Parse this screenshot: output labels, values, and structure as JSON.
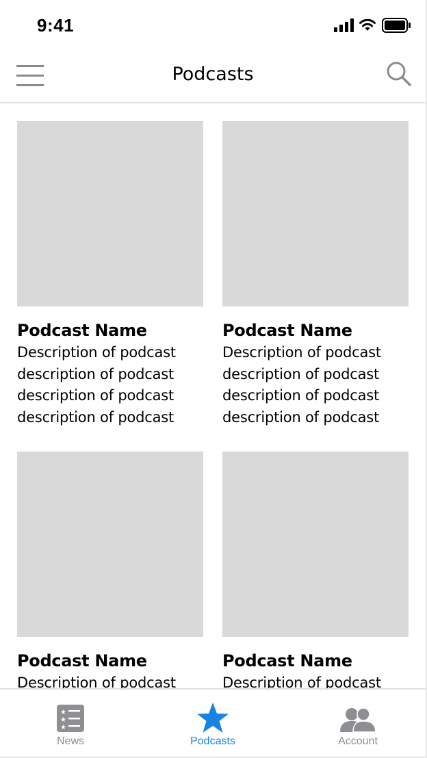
{
  "status_bar": {
    "time": "9:41"
  },
  "nav": {
    "title": "Podcasts",
    "menu_icon": "hamburger-menu-icon",
    "search_icon": "search-icon"
  },
  "podcasts": [
    {
      "name": "Podcast Name",
      "description": [
        "Description of podcast",
        "description of podcast",
        "description of podcast",
        "description of podcast"
      ]
    },
    {
      "name": "Podcast Name",
      "description": [
        "Description of podcast",
        "description of podcast",
        "description of podcast",
        "description of podcast"
      ]
    },
    {
      "name": "Podcast Name",
      "description": [
        "Description of podcast"
      ]
    },
    {
      "name": "Podcast Name",
      "description": [
        "Description of podcast"
      ]
    }
  ],
  "tab_bar": {
    "tabs": [
      {
        "label": "News",
        "icon": "news-list-icon",
        "active": false
      },
      {
        "label": "Podcasts",
        "icon": "star-icon",
        "active": true
      },
      {
        "label": "Account",
        "icon": "people-icon",
        "active": false
      }
    ]
  },
  "colors": {
    "accent": "#1a82e2",
    "inactive": "#8e8e93",
    "placeholder": "#d9d9d9"
  }
}
